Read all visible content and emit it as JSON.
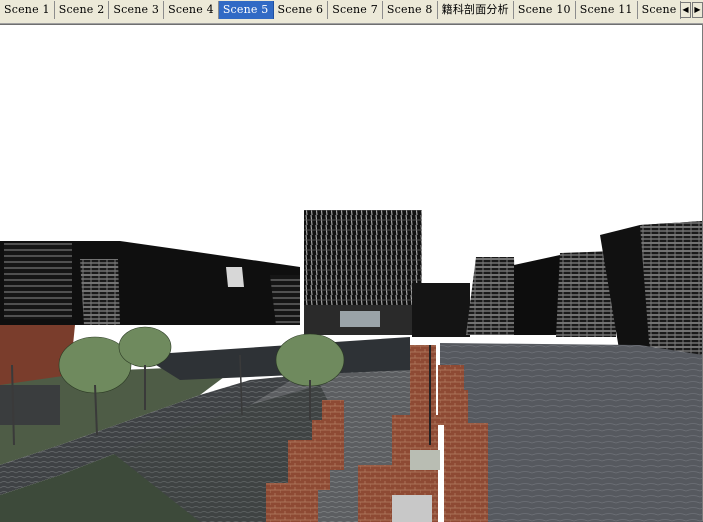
{
  "scene_tabs": [
    {
      "label": "Scene 1",
      "active": false
    },
    {
      "label": "Scene 2",
      "active": false
    },
    {
      "label": "Scene 3",
      "active": false
    },
    {
      "label": "Scene 4",
      "active": false
    },
    {
      "label": "Scene 5",
      "active": true
    },
    {
      "label": "Scene 6",
      "active": false
    },
    {
      "label": "Scene 7",
      "active": false
    },
    {
      "label": "Scene 8",
      "active": false
    },
    {
      "label": "籍科剖面分析",
      "active": false
    },
    {
      "label": "Scene 10",
      "active": false
    },
    {
      "label": "Scene 11",
      "active": false
    },
    {
      "label": "Scene",
      "active": false
    }
  ],
  "nav": {
    "prev_glyph": "◀",
    "next_glyph": "▶"
  },
  "colors": {
    "active_tab": "#316ac5",
    "brick": "#8e4a34",
    "lawn": "#4e5c46",
    "building_dark": "#101010",
    "plaza": "#56595f"
  }
}
